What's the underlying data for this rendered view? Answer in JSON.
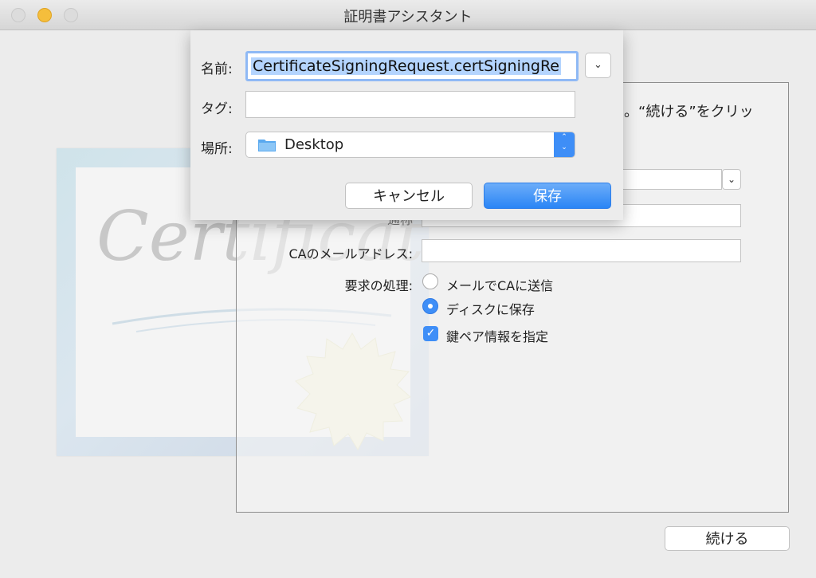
{
  "window": {
    "title": "証明書アシスタント"
  },
  "main": {
    "instruction_fragment": "。“続ける”をクリッ",
    "labels": {
      "ca_email": "CAのメールアドレス:",
      "request_handling": "要求の処理:",
      "partial_hidden": "通称"
    },
    "options": [
      {
        "label": "メールでCAに送信",
        "selected": false
      },
      {
        "label": "ディスクに保存",
        "selected": true
      }
    ],
    "checkbox": {
      "label": "鍵ペア情報を指定",
      "checked": true
    },
    "continue_label": "続ける"
  },
  "save_sheet": {
    "name_label": "名前:",
    "name_value": "CertificateSigningRequest.certSigningRe",
    "tags_label": "タグ:",
    "location_label": "場所:",
    "location_value": "Desktop",
    "cancel_label": "キャンセル",
    "save_label": "保存"
  },
  "colors": {
    "accent": "#3e8ef7",
    "minimize": "#f5be3c"
  }
}
